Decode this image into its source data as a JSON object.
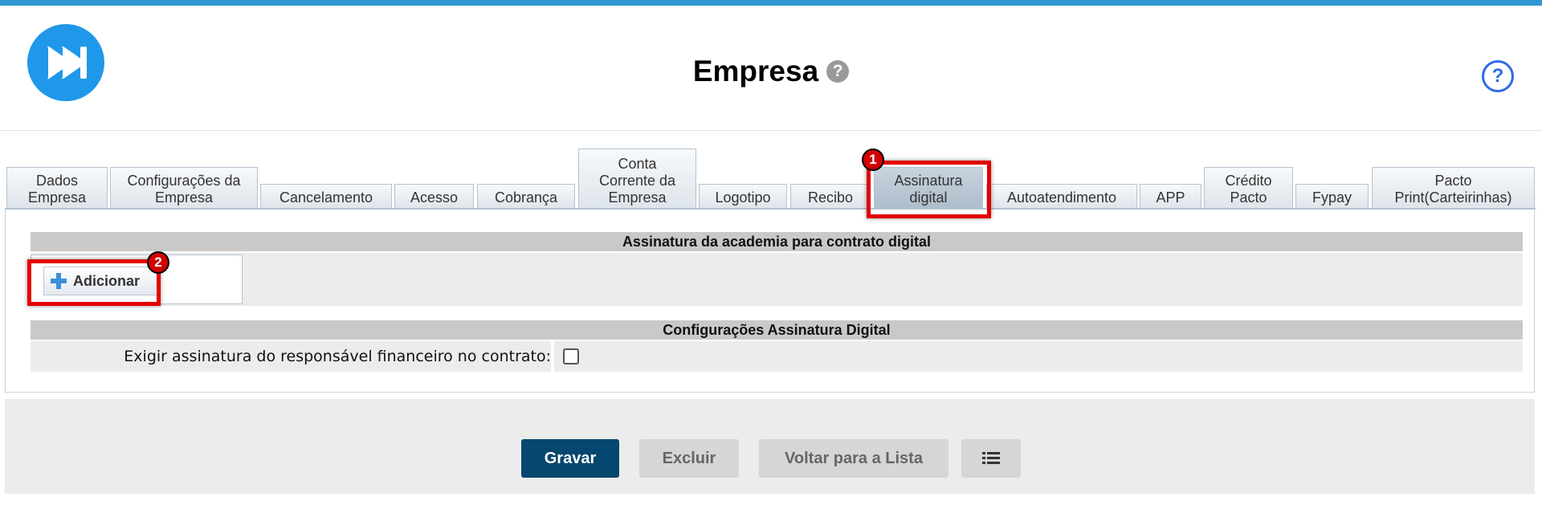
{
  "header": {
    "title": "Empresa",
    "title_help_glyph": "?",
    "help_glyph": "?",
    "logo_icon": "fast-forward-logo",
    "accent_color": "#2f96d3"
  },
  "tabs": [
    {
      "label": "Dados Empresa"
    },
    {
      "label": "Configurações da Empresa"
    },
    {
      "label": "Cancelamento"
    },
    {
      "label": "Acesso"
    },
    {
      "label": "Cobrança"
    },
    {
      "label": "Conta Corrente da Empresa"
    },
    {
      "label": "Logotipo"
    },
    {
      "label": "Recibo"
    },
    {
      "label": "Assinatura digital",
      "active": true
    },
    {
      "label": "Autoatendimento"
    },
    {
      "label": "APP"
    },
    {
      "label": "Crédito Pacto"
    },
    {
      "label": "Fypay"
    },
    {
      "label": "Pacto Print(Carteirinhas)"
    }
  ],
  "signature_section": {
    "header": "Assinatura da academia para contrato digital",
    "add_button": "Adicionar"
  },
  "config_section": {
    "header": "Configurações Assinatura Digital",
    "require_guardian_label": "Exigir assinatura do responsável financeiro no contrato:",
    "require_guardian_checked": false
  },
  "annotations": {
    "step1": "1",
    "step2": "2",
    "color": "#e30000"
  },
  "footer": {
    "save": "Gravar",
    "delete": "Excluir",
    "back": "Voltar para a Lista",
    "list_icon": "list-icon"
  }
}
